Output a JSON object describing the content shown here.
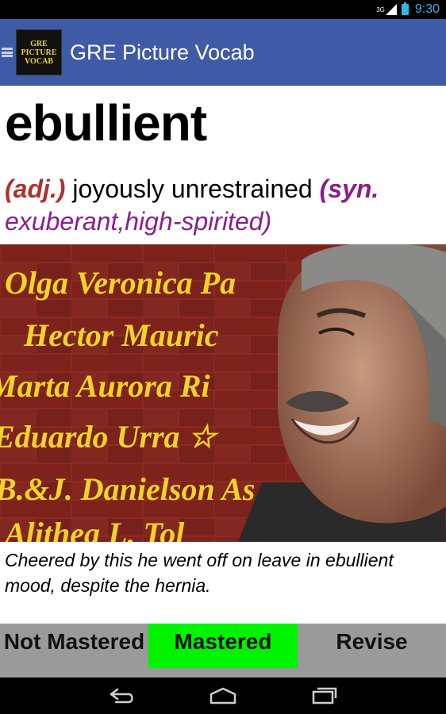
{
  "status_bar": {
    "network": "3G",
    "time": "9:30"
  },
  "app": {
    "title": "GRE Picture Vocab",
    "logo_lines": [
      "GRE",
      "PICTURE",
      "VOCAB"
    ]
  },
  "card": {
    "word": "ebullient",
    "part_of_speech": "(adj.)",
    "definition": "joyously unrestrained",
    "syn_label": "(syn.",
    "synonyms": "exuberant,high-spirited)",
    "image_text": [
      "Olga Veronica Pa",
      "Hector Mauric",
      "Marta Aurora Ri",
      "Eduardo Urra ☆",
      "B.&J. Danielson  As",
      "Alithea L. Tol"
    ],
    "example_sentence": "Cheered by this he went off on leave in ebullient mood, despite the hernia."
  },
  "buttons": {
    "not_mastered": "Not Mastered",
    "mastered": "Mastered",
    "revise": "Revise"
  },
  "colors": {
    "action_bar": "#3f5aa6",
    "mastered_bg": "#00f400",
    "part_of_speech": "#b1302e",
    "synonyms": "#8a1d8c"
  },
  "nav_icons": [
    "back-icon",
    "home-icon",
    "recent-apps-icon"
  ]
}
